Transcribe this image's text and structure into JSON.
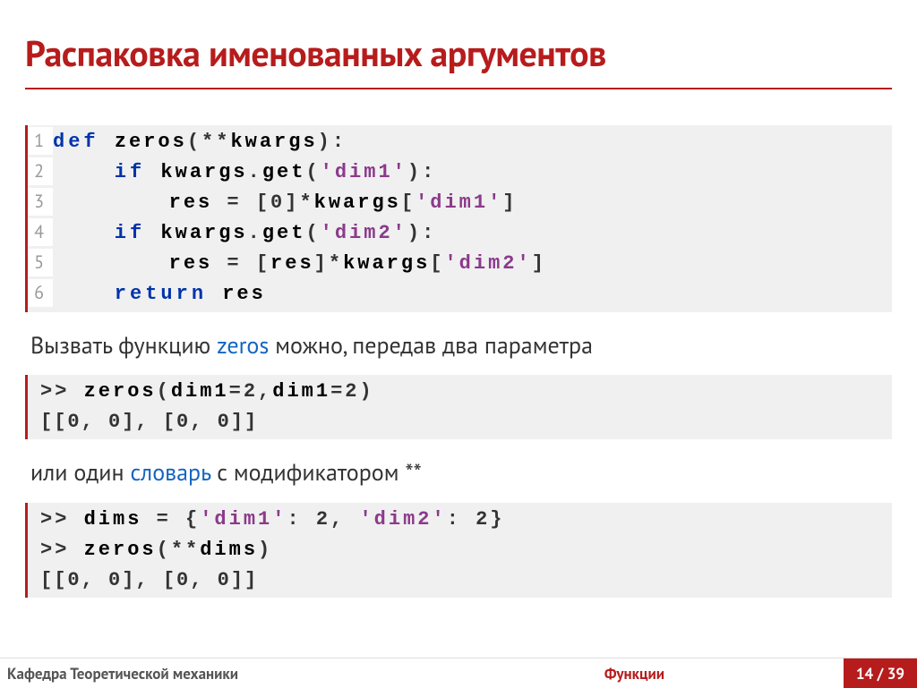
{
  "title": "Распаковка именованных аргументов",
  "code1": {
    "l1a": "def ",
    "l1b": "zeros",
    "l1c": "(**",
    "l1d": "kwargs",
    "l1e": "):",
    "l2a": "    if ",
    "l2b": "kwargs",
    "l2c": ".",
    "l2d": "get",
    "l2e": "(",
    "l2f": "'dim1'",
    "l2g": "):",
    "l3a": "        res",
    "l3b": " = [0]*",
    "l3c": "kwargs",
    "l3d": "[",
    "l3e": "'dim1'",
    "l3f": "]",
    "l4a": "    if ",
    "l4b": "kwargs",
    "l4c": ".",
    "l4d": "get",
    "l4e": "(",
    "l4f": "'dim2'",
    "l4g": "):",
    "l5a": "        res",
    "l5b": " = [",
    "l5c": "res",
    "l5d": "]*",
    "l5e": "kwargs",
    "l5f": "[",
    "l5g": "'dim2'",
    "l5h": "]",
    "l6a": "    return ",
    "l6b": "res"
  },
  "text1_a": "Вызвать функцию ",
  "text1_b": "zeros",
  "text1_c": " можно, передав два параметра",
  "code2": {
    "l1a": ">> ",
    "l1b": "zeros",
    "l1c": "(",
    "l1d": "dim1",
    "l1e": "=2,",
    "l1f": "dim1",
    "l1g": "=2)",
    "l2": "[[0, 0], [0, 0]]"
  },
  "text2_a": "или один ",
  "text2_b": "словарь",
  "text2_c": " с модификатором **",
  "code3": {
    "l1a": ">> ",
    "l1b": "dims",
    "l1c": " = {",
    "l1d": "'dim1'",
    "l1e": ": 2, ",
    "l1f": "'dim2'",
    "l1g": ": 2}",
    "l2a": ">> ",
    "l2b": "zeros",
    "l2c": "(**",
    "l2d": "dims",
    "l2e": ")",
    "l3": "[[0, 0], [0, 0]]"
  },
  "footer": {
    "left": "Кафедра Теоретической механики",
    "center": "Функции",
    "page": "14 / 39"
  },
  "linenos": [
    "1",
    "2",
    "3",
    "4",
    "5",
    "6"
  ]
}
